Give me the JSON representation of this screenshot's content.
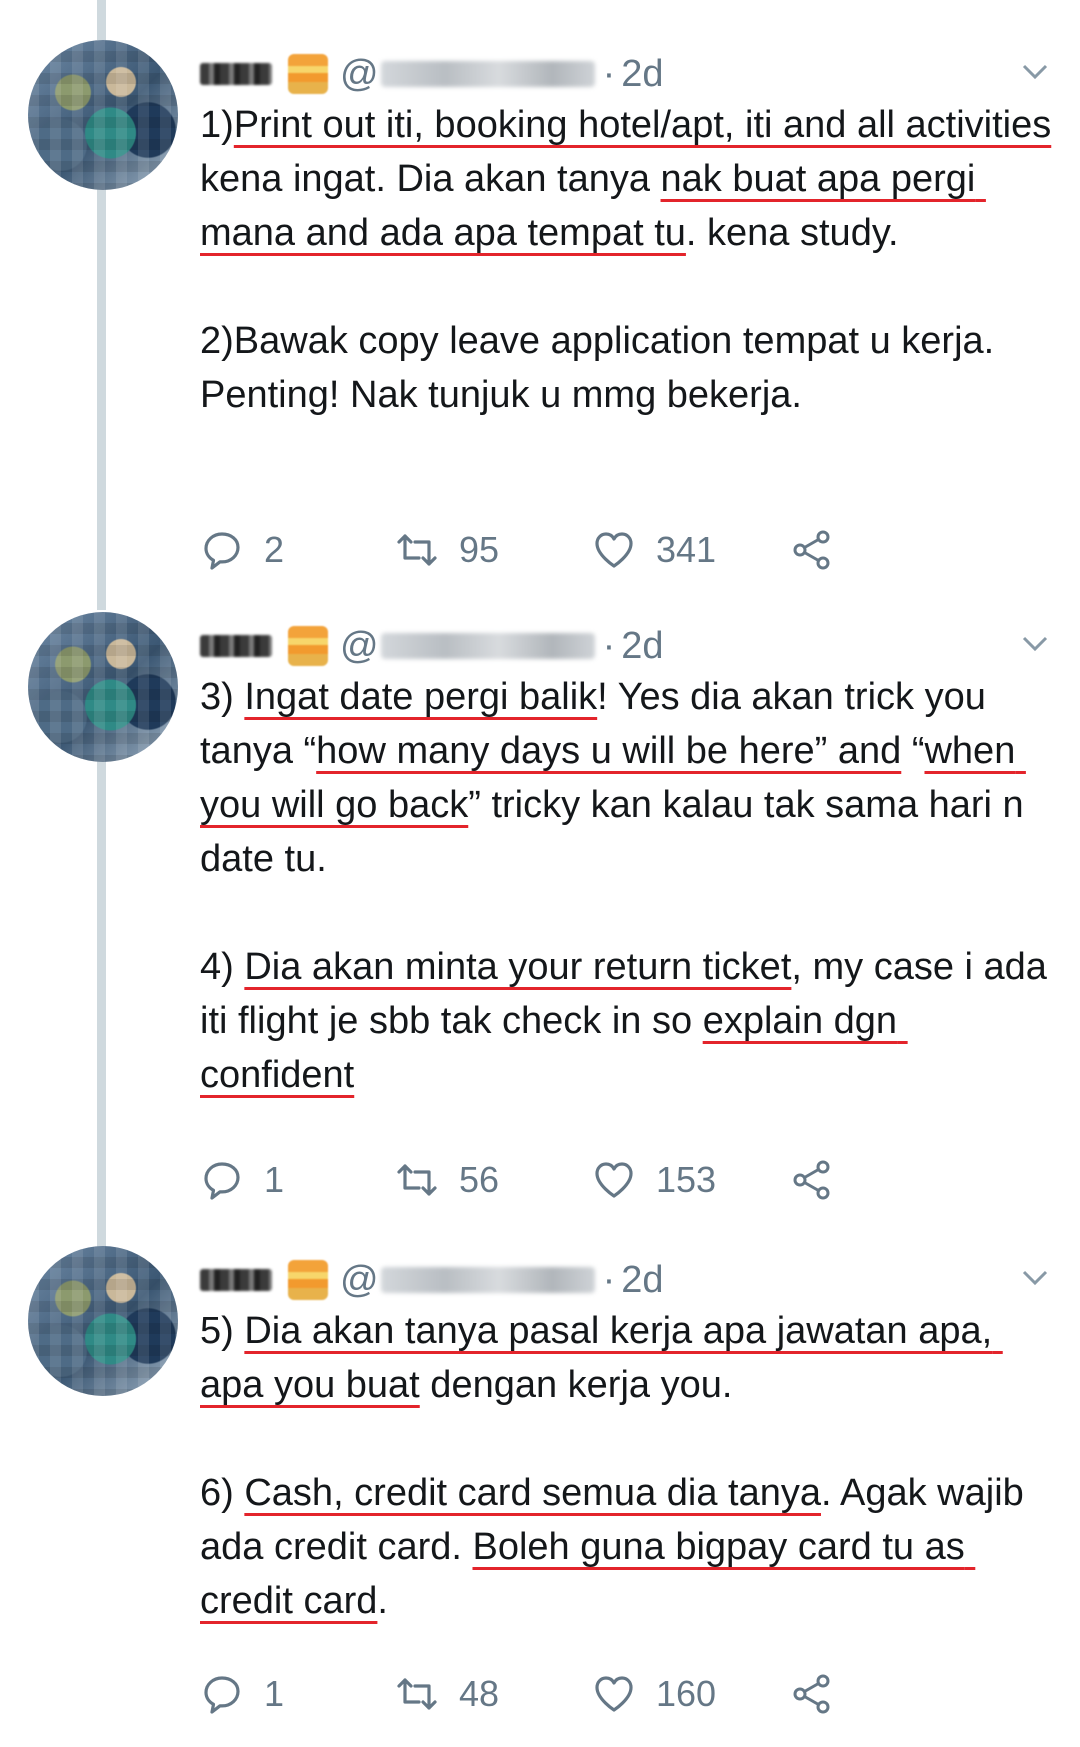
{
  "tweets": [
    {
      "timestamp": "2d",
      "at_symbol": "@",
      "separator": "·",
      "segments": [
        {
          "t": "1)",
          "u": false
        },
        {
          "t": "Print out iti, booking hotel/apt, iti and all activities",
          "u": true
        },
        {
          "t": " kena ingat. Dia akan tanya ",
          "u": false
        },
        {
          "t": "nak buat apa pergi mana and ada apa tempat tu",
          "u": true
        },
        {
          "t": ". kena study.\n\n2)Bawak copy leave application tempat u kerja. Penting! Nak tunjuk u mmg bekerja.",
          "u": false
        }
      ],
      "replies": "2",
      "retweets": "95",
      "likes": "341"
    },
    {
      "timestamp": "2d",
      "at_symbol": "@",
      "separator": "·",
      "segments": [
        {
          "t": "3) ",
          "u": false
        },
        {
          "t": "Ingat date pergi balik",
          "u": true
        },
        {
          "t": "! Yes dia akan trick you tanya “",
          "u": false
        },
        {
          "t": "how many days u will be here” and",
          "u": true
        },
        {
          "t": " “",
          "u": false
        },
        {
          "t": "when you will go back",
          "u": true
        },
        {
          "t": "” tricky kan kalau tak sama hari n date tu.\n\n4) ",
          "u": false
        },
        {
          "t": "Dia akan minta your return ticket",
          "u": true
        },
        {
          "t": ", my case i ada iti flight je sbb tak check in so ",
          "u": false
        },
        {
          "t": "explain dgn confident",
          "u": true
        }
      ],
      "replies": "1",
      "retweets": "56",
      "likes": "153"
    },
    {
      "timestamp": "2d",
      "at_symbol": "@",
      "separator": "·",
      "segments": [
        {
          "t": "5) ",
          "u": false
        },
        {
          "t": "Dia akan tanya pasal kerja apa jawatan apa, apa you buat",
          "u": true
        },
        {
          "t": " dengan kerja you.\n\n6) ",
          "u": false
        },
        {
          "t": "Cash, credit card semua dia tanya",
          "u": true
        },
        {
          "t": ". Agak wajib ada credit card. ",
          "u": false
        },
        {
          "t": "Boleh guna bigpay card tu as credit card",
          "u": true
        },
        {
          "t": ".",
          "u": false
        }
      ],
      "replies": "1",
      "retweets": "48",
      "likes": "160"
    }
  ],
  "icons": {
    "reply": "reply-icon",
    "retweet": "retweet-icon",
    "like": "heart-icon",
    "share": "share-icon",
    "menu": "chevron-down-icon"
  },
  "colors": {
    "underline": "#e3242b",
    "secondary_text": "#657786",
    "thread_line": "#cfd9de"
  }
}
